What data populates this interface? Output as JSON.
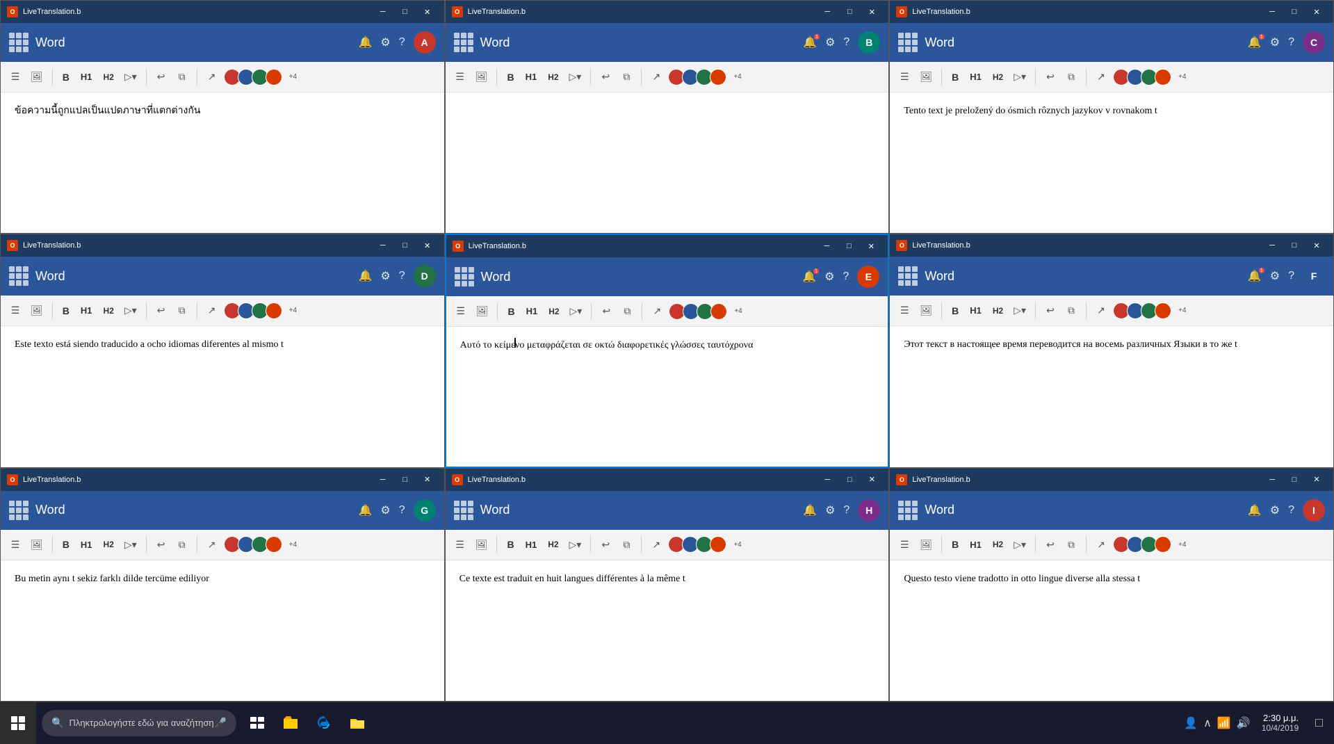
{
  "windows": [
    {
      "id": "win-top-left",
      "titlebar": "LiveTranslation.b",
      "app_title": "Word",
      "content_text": "ข้อความนี้ถูกแปลเป็นแปดภาษาที่แตกต่างกัน",
      "has_cursor": false,
      "row": 0,
      "col": 0,
      "notification_count": ""
    },
    {
      "id": "win-top-center",
      "titlebar": "LiveTranslation.b",
      "app_title": "Word",
      "content_text": "",
      "has_cursor": false,
      "row": 0,
      "col": 1,
      "notification_count": "1"
    },
    {
      "id": "win-top-right",
      "titlebar": "LiveTranslation.b",
      "app_title": "Word",
      "content_text": "Tento text je preložený do ósmich rôznych jazykov v rovnakom t",
      "has_cursor": false,
      "row": 0,
      "col": 2,
      "notification_count": "1"
    },
    {
      "id": "win-mid-left",
      "titlebar": "LiveTranslation.b",
      "app_title": "Word",
      "content_text": "Este texto está siendo traducido a ocho idiomas diferentes al mismo t",
      "has_cursor": false,
      "row": 1,
      "col": 0,
      "notification_count": ""
    },
    {
      "id": "win-mid-center",
      "titlebar": "LiveTranslation.b",
      "app_title": "Word",
      "content_text": "Αυτό το κείμενο μεταφράζεται σε οκτώ διαφορετικές γλώσσες ταυτόχρονα",
      "has_cursor": true,
      "row": 1,
      "col": 1,
      "notification_count": "1"
    },
    {
      "id": "win-mid-right",
      "titlebar": "LiveTranslation.b",
      "app_title": "Word",
      "content_text": "Этот текст в настоящее время переводится на восемь различных Языки в то же t",
      "has_cursor": false,
      "row": 1,
      "col": 2,
      "notification_count": "1"
    },
    {
      "id": "win-bot-left",
      "titlebar": "LiveTranslation.b",
      "app_title": "Word",
      "content_text": "Bu metin aynı t sekiz farklı dilde tercüme ediliyor",
      "has_cursor": false,
      "row": 2,
      "col": 0,
      "notification_count": ""
    },
    {
      "id": "win-bot-center",
      "titlebar": "LiveTranslation.b",
      "app_title": "Word",
      "content_text": "Ce texte est traduit en huit langues différentes à la même t",
      "has_cursor": false,
      "row": 2,
      "col": 1,
      "notification_count": ""
    },
    {
      "id": "win-bot-right",
      "titlebar": "LiveTranslation.b",
      "app_title": "Word",
      "content_text": "Questo testo viene tradotto in otto lingue diverse alla stessa t",
      "has_cursor": false,
      "row": 2,
      "col": 2,
      "notification_count": ""
    }
  ],
  "toolbar": {
    "bold": "B",
    "h1": "H1",
    "h2": "H2",
    "play": "▷▾",
    "plus_count": "+4"
  },
  "taskbar": {
    "search_placeholder": "Πληκτρολογήστε εδώ για αναζήτηση",
    "clock_time": "2:30 μ.μ.",
    "clock_date": "10/4/2019"
  },
  "window_controls": {
    "minimize": "─",
    "maximize": "□",
    "close": "✕"
  },
  "title_label": "LiveTranslation.b",
  "header_icons": {
    "bell": "🔔",
    "gear": "⚙",
    "help": "?",
    "bell_badge": "1"
  }
}
